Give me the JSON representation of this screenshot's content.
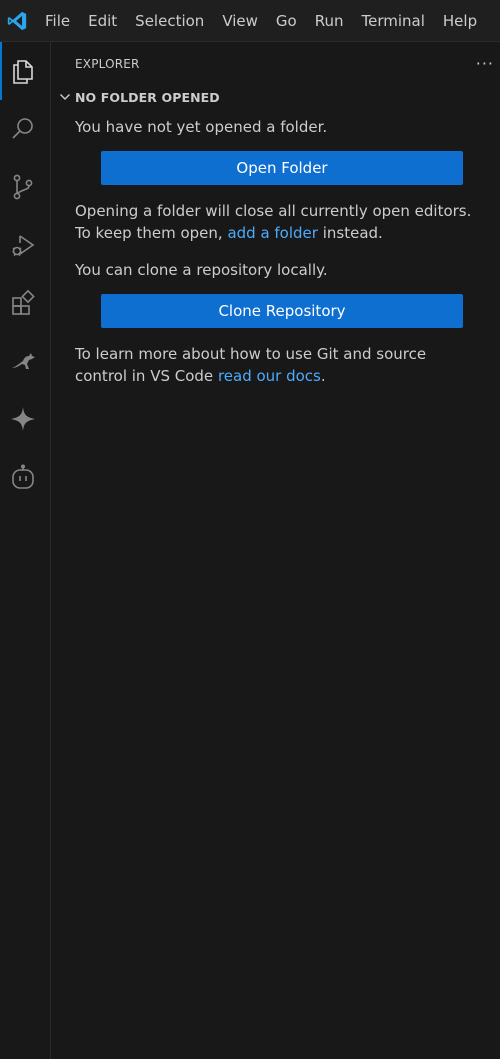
{
  "menu": {
    "items": [
      "File",
      "Edit",
      "Selection",
      "View",
      "Go",
      "Run",
      "Terminal",
      "Help"
    ]
  },
  "activity_bar": {
    "icons": [
      "explorer-icon",
      "search-icon",
      "source-control-icon",
      "run-debug-icon",
      "extensions-icon",
      "kangaroo-icon",
      "sparkle-icon",
      "copilot-icon"
    ]
  },
  "sidebar": {
    "title": "EXPLORER",
    "more_actions": "···",
    "section_title": "NO FOLDER OPENED",
    "welcome": {
      "msg_no_folder": "You have not yet opened a folder.",
      "open_folder_label": "Open Folder",
      "msg_close_pre": "Opening a folder will close all currently open editors. To keep them open, ",
      "add_folder_link": "add a folder",
      "msg_close_post": " instead.",
      "msg_clone": "You can clone a repository locally.",
      "clone_label": "Clone Repository",
      "msg_docs_pre": "To learn more about how to use Git and source control in VS Code ",
      "docs_link": "read our docs",
      "msg_docs_post": "."
    }
  },
  "colors": {
    "background": "#181818",
    "titlebar": "#1f1f1f",
    "accent": "#0e6fd1",
    "link": "#4daafc",
    "text": "#cccccc",
    "logo": "#2aa6f0"
  }
}
